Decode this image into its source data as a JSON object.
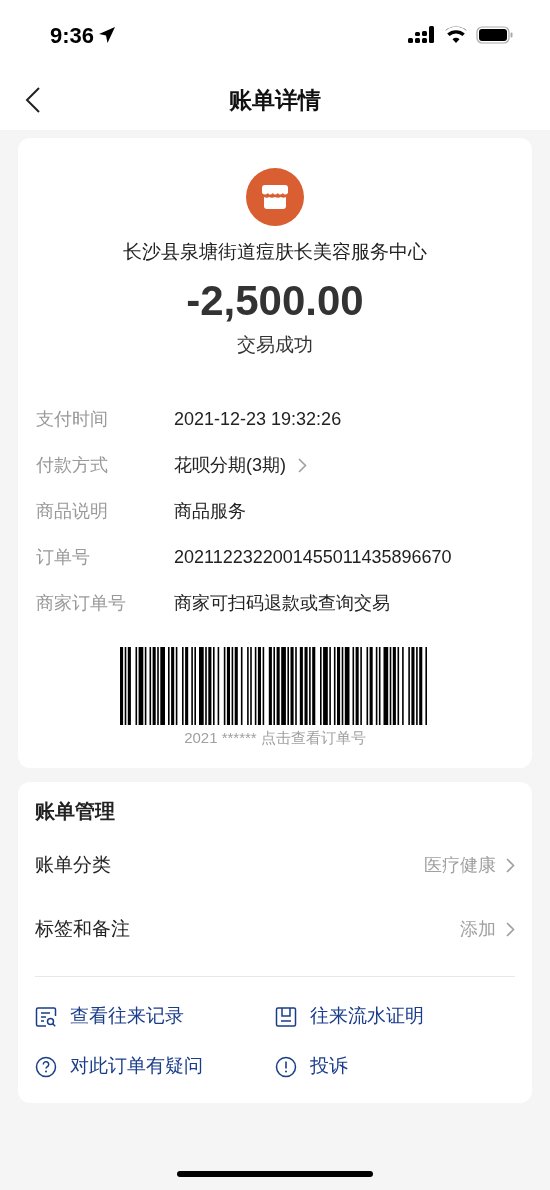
{
  "status_bar": {
    "time": "9:36"
  },
  "nav": {
    "title": "账单详情"
  },
  "summary": {
    "merchant": "长沙县泉塘街道痘肤长美容服务中心",
    "amount": "-2,500.00",
    "status": "交易成功"
  },
  "details": [
    {
      "label": "支付时间",
      "value": "2021-12-23 19:32:26",
      "link": false
    },
    {
      "label": "付款方式",
      "value": "花呗分期(3期)",
      "link": true
    },
    {
      "label": "商品说明",
      "value": "商品服务",
      "link": false
    },
    {
      "label": "订单号",
      "value": "2021122322001455011435896670",
      "link": false
    },
    {
      "label": "商家订单号",
      "value": "商家可扫码退款或查询交易",
      "link": false
    }
  ],
  "barcode": {
    "caption": "2021 ****** 点击查看订单号"
  },
  "management": {
    "title": "账单管理",
    "rows": [
      {
        "label": "账单分类",
        "value": "医疗健康"
      },
      {
        "label": "标签和备注",
        "value": "添加"
      }
    ],
    "actions": [
      {
        "kind": "record",
        "label": "查看往来记录"
      },
      {
        "kind": "statement",
        "label": "往来流水证明"
      },
      {
        "kind": "question",
        "label": "对此订单有疑问"
      },
      {
        "kind": "alert",
        "label": "投诉"
      }
    ]
  }
}
